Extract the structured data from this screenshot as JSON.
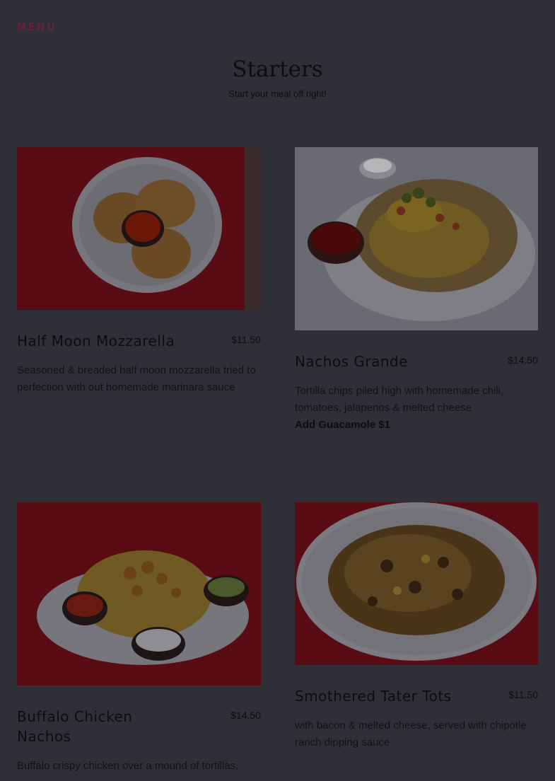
{
  "nav": {
    "menu_label": "MENU"
  },
  "section": {
    "title": "Starters",
    "subtitle": "Start your meal off right!"
  },
  "items": [
    {
      "name": "Half Moon Mozzarella",
      "price": "$11.50",
      "description": "Seasoned & breaded half moon mozzarella fried to perfection with out homemade marinara sauce",
      "extra": ""
    },
    {
      "name": "Nachos Grande",
      "price": "$14.50",
      "description": "Tortilla chips piled high with homemade chili, tomatoes, jalapenos & melted cheese",
      "extra": "Add Guacamole $1"
    },
    {
      "name": "Buffalo Chicken Nachos",
      "price": "$14.50",
      "description": "Buffalo crispy chicken over a mound of tortillas,",
      "extra": ""
    },
    {
      "name": "Smothered Tater Tots",
      "price": "$11.50",
      "description": "with bacon & melted cheese, served with chipotle ranch dipping sauce",
      "extra": ""
    }
  ],
  "colors": {
    "page_overlay": "#2f2f37",
    "menu_accent": "#7a1e3f",
    "tablecloth_red": "#5a0c14"
  }
}
